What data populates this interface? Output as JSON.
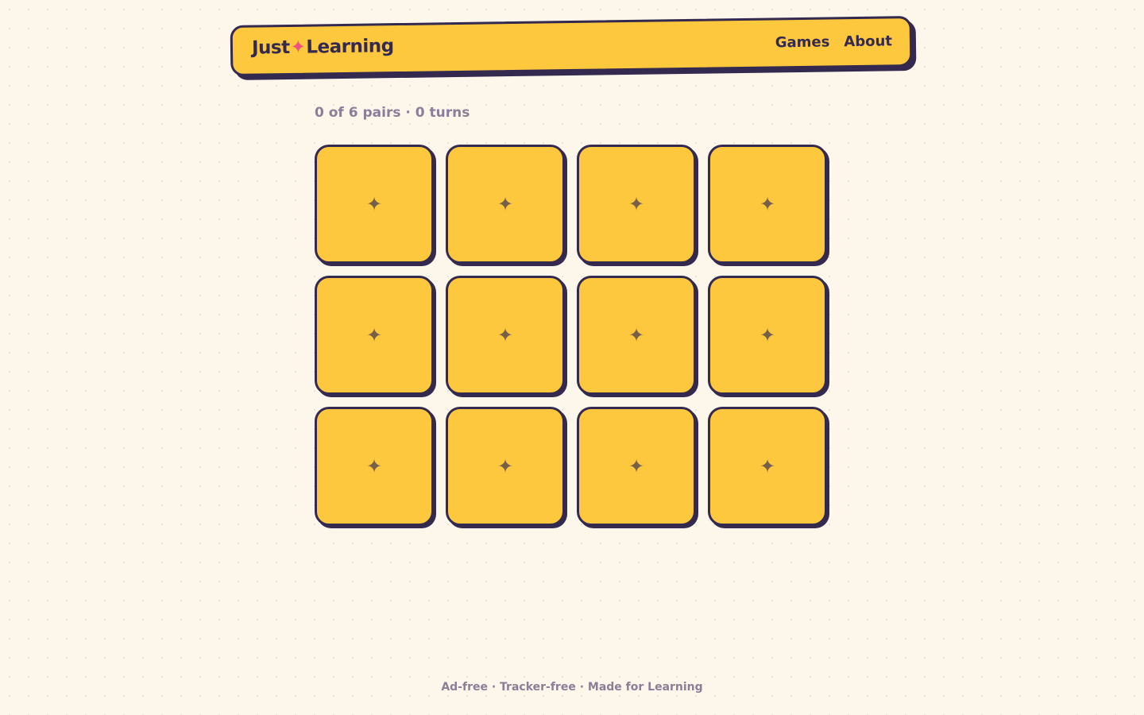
{
  "header": {
    "logo_left": "Just",
    "logo_sparkle": "✦",
    "logo_right": "Learning",
    "nav": [
      {
        "label": "Games"
      },
      {
        "label": "About"
      }
    ]
  },
  "status": {
    "text": "0 of 6 pairs · 0 turns",
    "pairs_found": 0,
    "pairs_total": 6,
    "turns": 0
  },
  "board": {
    "rows": 3,
    "columns": 4,
    "card_back_icon": "sparkle-icon",
    "card_back_glyph": "✦",
    "cards": [
      {
        "state": "face-down"
      },
      {
        "state": "face-down"
      },
      {
        "state": "face-down"
      },
      {
        "state": "face-down"
      },
      {
        "state": "face-down"
      },
      {
        "state": "face-down"
      },
      {
        "state": "face-down"
      },
      {
        "state": "face-down"
      },
      {
        "state": "face-down"
      },
      {
        "state": "face-down"
      },
      {
        "state": "face-down"
      },
      {
        "state": "face-down"
      }
    ]
  },
  "footer": {
    "text": "Ad-free · Tracker-free · Made for Learning"
  },
  "colors": {
    "background": "#fdf6ea",
    "accent": "#fec83e",
    "ink": "#34294f",
    "sparkle": "#f0507d",
    "muted": "#8a7e98"
  }
}
